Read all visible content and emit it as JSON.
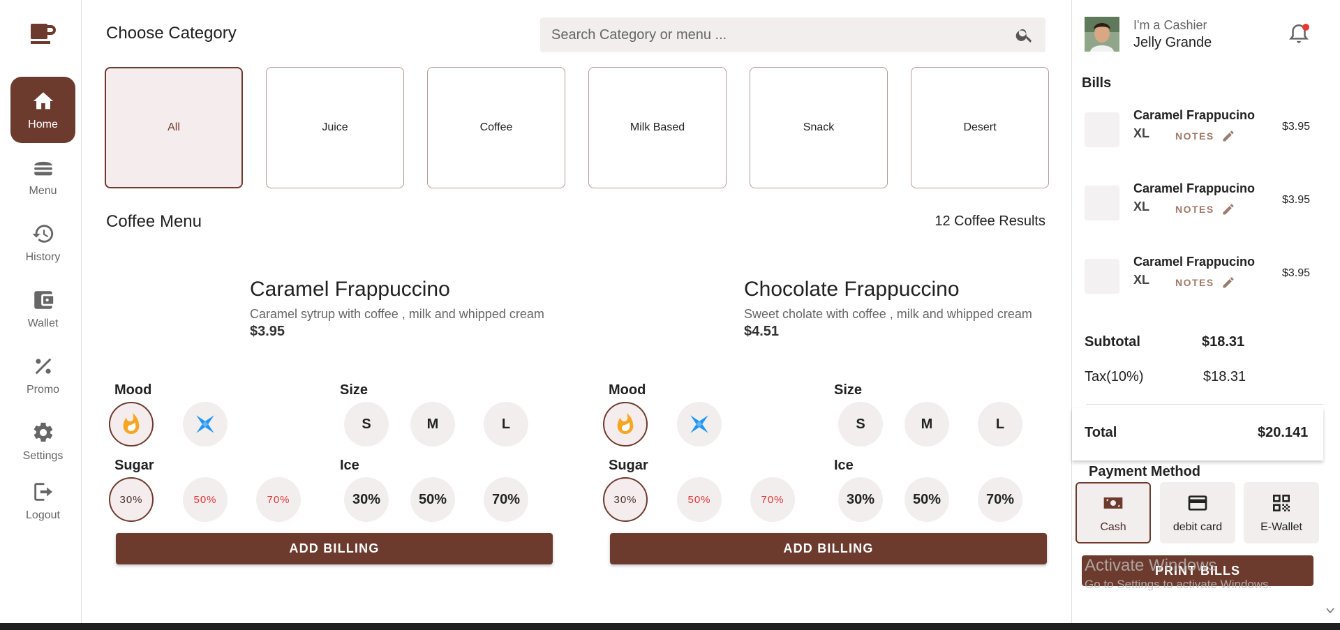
{
  "sidebar": {
    "logo": "coffee-cup-icon",
    "items": [
      {
        "label": "Home",
        "icon": "home-icon",
        "active": true
      },
      {
        "label": "Menu",
        "icon": "burger-icon"
      },
      {
        "label": "History",
        "icon": "history-icon"
      },
      {
        "label": "Wallet",
        "icon": "wallet-icon"
      },
      {
        "label": "Promo",
        "icon": "percent-icon"
      },
      {
        "label": "Settings",
        "icon": "gear-icon"
      },
      {
        "label": "Logout",
        "icon": "logout-icon"
      }
    ]
  },
  "main": {
    "category_title": "Choose Category",
    "search_placeholder": "Search Category or menu ...",
    "categories": [
      "All",
      "Juice",
      "Coffee",
      "Milk Based",
      "Snack",
      "Desert"
    ],
    "selected_category": "All",
    "menu_title": "Coffee Menu",
    "results": "12 Coffee Results",
    "products": [
      {
        "name": "Caramel Frappuccino",
        "description": "Caramel sytrup with coffee , milk and whipped cream",
        "price": "$3.95",
        "mood_label": "Mood",
        "size_label": "Size",
        "sizes": [
          "S",
          "M",
          "L"
        ],
        "sugar_label": "Sugar",
        "sugar_options": [
          "30%",
          "50%",
          "70%"
        ],
        "ice_label": "Ice",
        "ice_options": [
          "30%",
          "50%",
          "70%"
        ],
        "button": "ADD BILLING"
      },
      {
        "name": "Chocolate Frappuccino",
        "description": "Sweet cholate with coffee , milk and whipped cream",
        "price": "$4.51",
        "mood_label": "Mood",
        "size_label": "Size",
        "sizes": [
          "S",
          "M",
          "L"
        ],
        "sugar_label": "Sugar",
        "sugar_options": [
          "30%",
          "50%",
          "70%"
        ],
        "ice_label": "Ice",
        "ice_options": [
          "30%",
          "50%",
          "70%"
        ],
        "button": "ADD BILLING"
      }
    ]
  },
  "panel": {
    "role": "I'm a Cashier",
    "cashier_name": "Jelly Grande",
    "bills_title": "Bills",
    "bills": [
      {
        "name": "Caramel Frappucino",
        "size": "XL",
        "notes": "NOTES",
        "price": "$3.95"
      },
      {
        "name": "Caramel Frappucino",
        "size": "XL",
        "notes": "NOTES",
        "price": "$3.95"
      },
      {
        "name": "Caramel Frappucino",
        "size": "XL",
        "notes": "NOTES",
        "price": "$3.95"
      }
    ],
    "subtotal_label": "Subtotal",
    "subtotal_value": "$18.31",
    "tax_label": "Tax(10%)",
    "tax_value": "$18.31",
    "total_label": "Total",
    "total_value": "$20.141",
    "payment_title": "Payment Method",
    "payment_methods": [
      "Cash",
      "debit card",
      "E-Wallet"
    ],
    "print_button": "PRINT BILLS",
    "watermark_title": "Activate Windows",
    "watermark_sub": "Go to Settings to activate Windows."
  },
  "colors": {
    "accent": "#6d3b2d",
    "selected_bg": "#f5eded",
    "chip_bg": "#f3eeee",
    "percent_text": "#dd3333",
    "fire": "#f5a623",
    "ice_blue": "#2196f3",
    "notification": "#e53935"
  }
}
